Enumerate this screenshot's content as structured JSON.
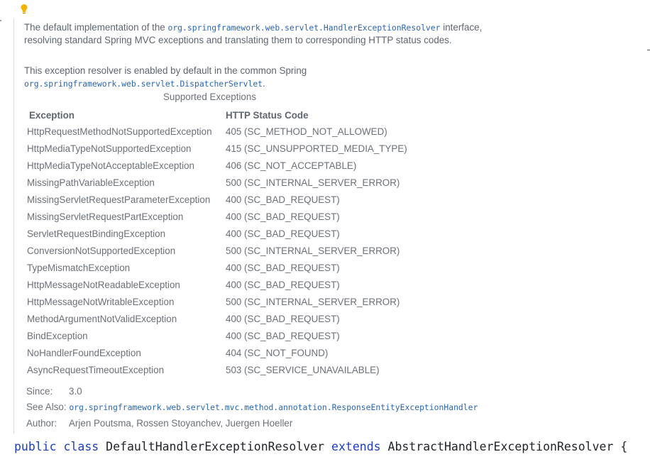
{
  "javadoc": {
    "para1": {
      "text_before": "The default implementation of the ",
      "link": "org.springframework.web.servlet.HandlerExceptionResolver",
      "text_after": " interface, resolving standard Spring MVC exceptions and translating them to corresponding HTTP status codes."
    },
    "para2": {
      "text_before": "This exception resolver is enabled by default in the common Spring ",
      "link": "org.springframework.web.servlet.DispatcherServlet",
      "text_after": "."
    },
    "table": {
      "caption": "Supported Exceptions",
      "headers": [
        "Exception",
        "HTTP Status Code"
      ],
      "rows": [
        [
          "HttpRequestMethodNotSupportedException",
          "405 (SC_METHOD_NOT_ALLOWED)"
        ],
        [
          "HttpMediaTypeNotSupportedException",
          "415 (SC_UNSUPPORTED_MEDIA_TYPE)"
        ],
        [
          "HttpMediaTypeNotAcceptableException",
          "406 (SC_NOT_ACCEPTABLE)"
        ],
        [
          "MissingPathVariableException",
          "500 (SC_INTERNAL_SERVER_ERROR)"
        ],
        [
          "MissingServletRequestParameterException",
          "400 (SC_BAD_REQUEST)"
        ],
        [
          "MissingServletRequestPartException",
          "400 (SC_BAD_REQUEST)"
        ],
        [
          "ServletRequestBindingException",
          "400 (SC_BAD_REQUEST)"
        ],
        [
          "ConversionNotSupportedException",
          "500 (SC_INTERNAL_SERVER_ERROR)"
        ],
        [
          "TypeMismatchException",
          "400 (SC_BAD_REQUEST)"
        ],
        [
          "HttpMessageNotReadableException",
          "400 (SC_BAD_REQUEST)"
        ],
        [
          "HttpMessageNotWritableException",
          "500 (SC_INTERNAL_SERVER_ERROR)"
        ],
        [
          "MethodArgumentNotValidException",
          "400 (SC_BAD_REQUEST)"
        ],
        [
          "BindException",
          "400 (SC_BAD_REQUEST)"
        ],
        [
          "NoHandlerFoundException",
          "404 (SC_NOT_FOUND)"
        ],
        [
          "AsyncRequestTimeoutException",
          "503 (SC_SERVICE_UNAVAILABLE)"
        ]
      ]
    },
    "since": {
      "label": "Since:",
      "value": "3.0"
    },
    "see_also": {
      "label": "See Also:",
      "value": "org.springframework.web.servlet.mvc.method.annotation.ResponseEntityExceptionHandler"
    },
    "author": {
      "label": "Author:",
      "value": "Arjen Poutsma, Rossen Stoyanchev, Juergen Hoeller"
    }
  },
  "code": {
    "kw_public": "public",
    "kw_class": "class",
    "class_name": "DefaultHandlerExceptionResolver",
    "kw_extends": "extends",
    "parent_class": "AbstractHandlerExceptionResolver",
    "brace": "{"
  },
  "icons": {
    "bulb": "lightbulb-icon"
  },
  "colors": {
    "link": "#2a66b6",
    "keyword": "#1d3fbf",
    "bulb": "#f0b400"
  }
}
